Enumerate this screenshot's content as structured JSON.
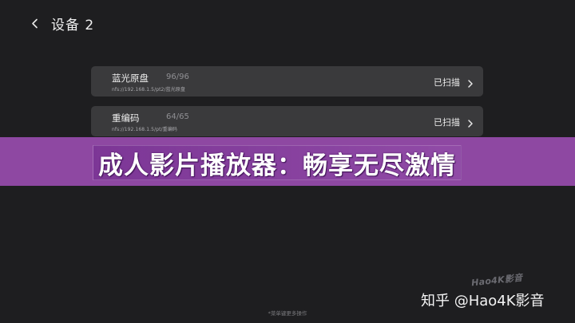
{
  "header": {
    "title": "设备 2",
    "back_icon": "chevron-left-icon"
  },
  "sources": [
    {
      "name": "蓝光原盘",
      "count": "96/96",
      "path": "nfs://192.168.1.5/pt2/蓝光原盘",
      "status": "已扫描",
      "icon": "chevron-right-icon"
    },
    {
      "name": "重编码",
      "count": "64/65",
      "path": "nfs://192.168.1.5/pt/重编码",
      "status": "已扫描",
      "icon": "chevron-right-icon"
    }
  ],
  "banner": {
    "text": "成人影片播放器：畅享无尽激情",
    "color": "#8e48a2"
  },
  "watermark": {
    "logo": "Hao4K影音",
    "credit": "知乎 @Hao4K影音"
  },
  "footer": {
    "hint": "*菜单键更多操作"
  }
}
